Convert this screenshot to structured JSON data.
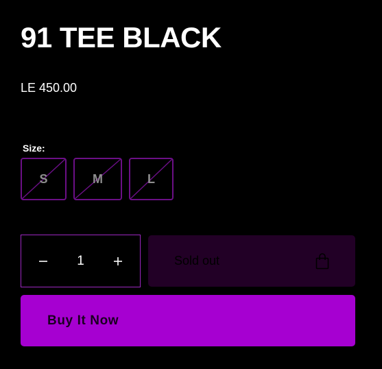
{
  "product": {
    "title": "91 TEE BLACK",
    "price": "LE 450.00"
  },
  "size": {
    "label": "Size:",
    "options": [
      "S",
      "M",
      "L"
    ],
    "all_sold_out": true
  },
  "quantity": {
    "value": "1",
    "decrease_icon": "minus-icon",
    "increase_icon": "plus-icon"
  },
  "cart_button": {
    "label": "Sold out",
    "icon": "shopping-bag-icon",
    "disabled": true
  },
  "buy_now": {
    "label": "Buy It Now"
  },
  "colors": {
    "background": "#000000",
    "accent": "#a600d1",
    "swatch_border": "#6b0f86",
    "soldout_bg": "#220026"
  }
}
